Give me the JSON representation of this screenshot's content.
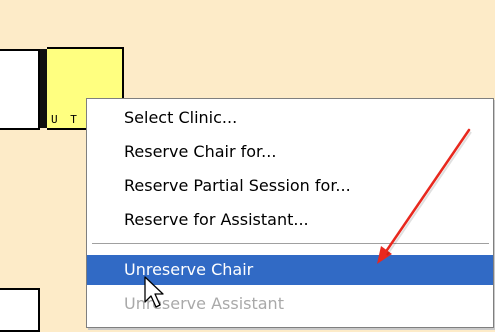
{
  "grid": {
    "yellow_cell_label": "U T"
  },
  "context_menu": {
    "items": [
      {
        "label": "Select Clinic...",
        "state": "normal"
      },
      {
        "label": "Reserve Chair for...",
        "state": "normal"
      },
      {
        "label": "Reserve Partial Session for...",
        "state": "normal"
      },
      {
        "label": "Reserve for Assistant...",
        "state": "normal"
      },
      {
        "label": "Unreserve Chair",
        "state": "highlighted"
      },
      {
        "label": "Unreserve Assistant",
        "state": "disabled"
      }
    ]
  },
  "annotation": {
    "arrow_color": "#e8281e",
    "points_to": "Unreserve Chair"
  },
  "cursor": {
    "icon": "arrow-cursor-icon"
  },
  "colors": {
    "background": "#fdebc8",
    "highlight": "#316ac5",
    "cell_yellow": "#ffff80",
    "disabled_text": "#a9a9a9"
  }
}
